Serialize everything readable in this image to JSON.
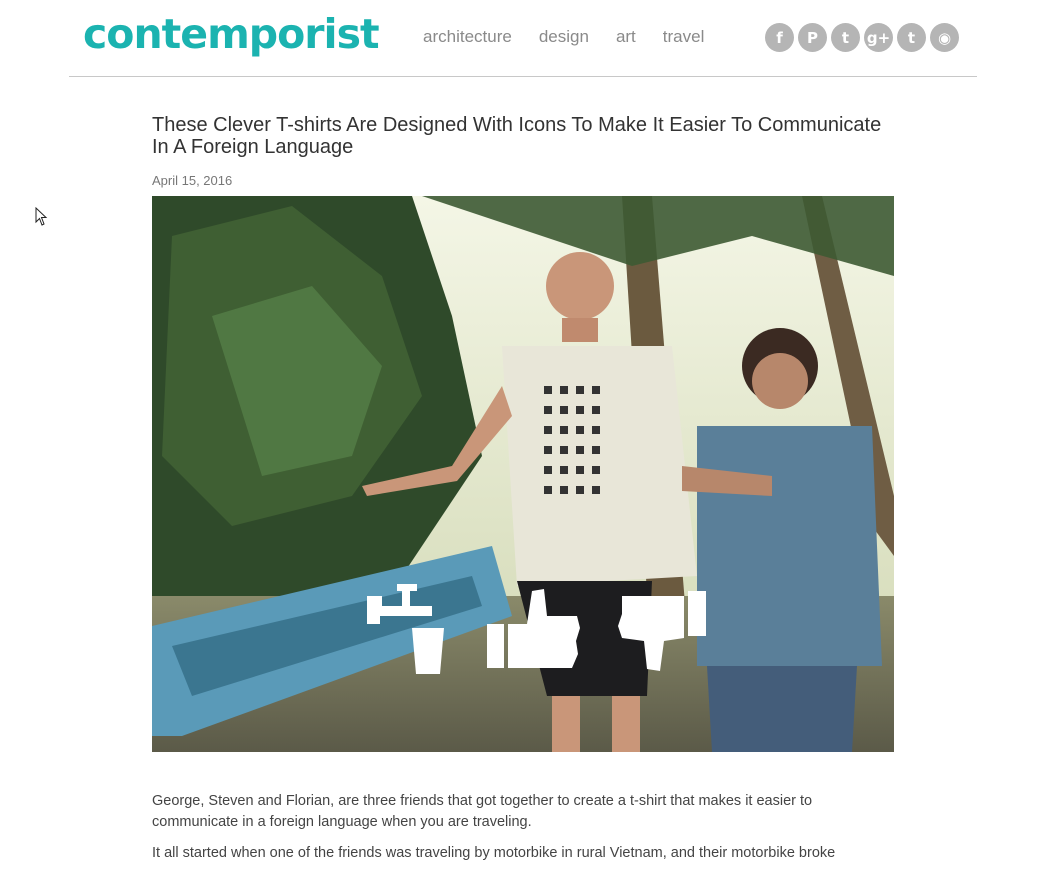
{
  "header": {
    "logo": "contemporist",
    "nav": [
      "architecture",
      "design",
      "art",
      "travel"
    ],
    "social": [
      {
        "icon": "facebook-icon",
        "glyph": "f"
      },
      {
        "icon": "pinterest-icon",
        "glyph": "P"
      },
      {
        "icon": "twitter-icon",
        "glyph": "t"
      },
      {
        "icon": "googleplus-icon",
        "glyph": "g+"
      },
      {
        "icon": "tumblr-icon",
        "glyph": "t"
      },
      {
        "icon": "rss-icon",
        "glyph": "◉"
      }
    ]
  },
  "article": {
    "title": "These Clever T-shirts Are Designed With Icons To Make It Easier To Communicate In A Foreign Language",
    "date": "April 15, 2016",
    "paragraphs": [
      "George, Steven and Florian, are three friends that got together to create a t-shirt that makes it easier to communicate in a foreign language when you are traveling.",
      "It all started when one of the friends was traveling by motorbike in rural Vietnam, and their motorbike broke"
    ]
  },
  "colors": {
    "brand": "#1bb3b0",
    "nav": "#8a8a8a",
    "social": "#b5b5b5"
  }
}
